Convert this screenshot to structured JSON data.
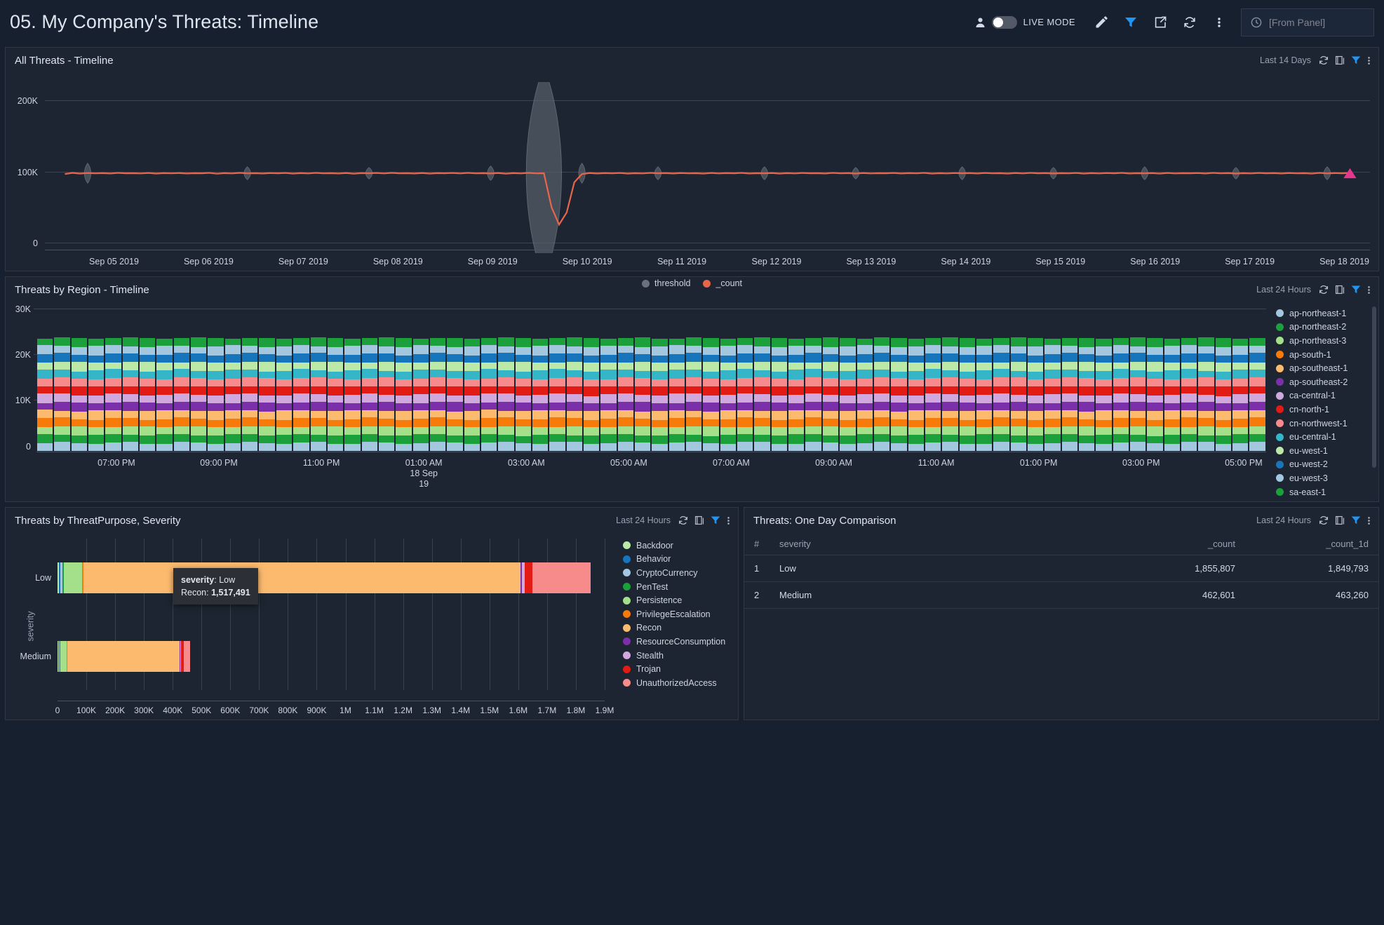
{
  "header": {
    "title": "05. My Company's Threats: Timeline",
    "live_mode_label": "LIVE MODE",
    "user_icon": "user-icon",
    "edit_icon": "pencil-icon",
    "filter_icon": "filter-icon",
    "share_icon": "share-icon",
    "refresh_icon": "refresh-icon",
    "more_icon": "kebab-menu-icon",
    "timepicker": {
      "clock_icon": "clock-icon",
      "value": "[From Panel]"
    }
  },
  "panel_controls": {
    "refresh_icon": "refresh-icon",
    "duplicate_icon": "duplicate-icon",
    "filter_icon": "filter-icon",
    "more_icon": "kebab-menu-icon"
  },
  "panels": {
    "all_threats": {
      "title": "All Threats - Timeline",
      "range": "Last 14 Days"
    },
    "by_region": {
      "title": "Threats by Region - Timeline",
      "range": "Last 24 Hours"
    },
    "by_purpose": {
      "title": "Threats by ThreatPurpose, Severity",
      "range": "Last 24 Hours"
    },
    "one_day": {
      "title": "Threats: One Day Comparison",
      "range": "Last 24 Hours"
    }
  },
  "chart_data": [
    {
      "id": "all-threats-timeline",
      "type": "line",
      "title": "All Threats - Timeline",
      "xlabel": "",
      "ylabel": "",
      "ylim": [
        0,
        200000
      ],
      "yticks": [
        "0",
        "100K",
        "200K"
      ],
      "ytick_values": [
        0,
        100000,
        200000
      ],
      "grid": true,
      "xtick_labels": [
        "Sep 05 2019",
        "Sep 06 2019",
        "Sep 07 2019",
        "Sep 08 2019",
        "Sep 09 2019",
        "Sep 10 2019",
        "Sep 11 2019",
        "Sep 12 2019",
        "Sep 13 2019",
        "Sep 14 2019",
        "Sep 15 2019",
        "Sep 16 2019",
        "Sep 17 2019",
        "Sep 18 2019"
      ],
      "legend": [
        {
          "label": "threshold",
          "color": "#6a717d"
        },
        {
          "label": "_count",
          "color": "#e7664c"
        }
      ],
      "legend_position": "bottom",
      "series": [
        {
          "name": "_count",
          "color": "#e7664c",
          "values": [
            99000,
            100500,
            99500,
            100200,
            99800,
            100100,
            99600,
            100400,
            99900,
            100000,
            99700,
            100300,
            99500,
            100100,
            99800,
            100200,
            99600,
            100000,
            99900,
            100400,
            99300,
            100100,
            99700,
            100500,
            99800,
            100000,
            99600,
            100200,
            99900,
            100300,
            99500,
            100100,
            99700,
            100400,
            99800,
            100000,
            99600,
            100200,
            99400,
            100100,
            99900,
            100300,
            99700,
            100500,
            99800,
            100000,
            99600,
            100200,
            99500,
            100100,
            99900,
            100300,
            99700,
            100400,
            99800,
            100000,
            99600,
            100200,
            99400,
            100100,
            99700,
            100500,
            99800,
            100000,
            55000,
            32000,
            48000,
            88000,
            99000,
            100200,
            99600,
            100100,
            99800,
            100300,
            99500,
            100000,
            99700,
            100400,
            99900,
            100100,
            99600,
            100200,
            99800,
            100000,
            99500,
            100300,
            99700,
            100100,
            99900,
            100400,
            99600,
            100000,
            99800,
            100200,
            99500,
            100100,
            99700,
            100300,
            99900,
            100000,
            99600,
            100400,
            99800,
            100100,
            99500,
            100200,
            99700,
            100000,
            99900,
            100300,
            99600,
            100100,
            99800,
            100400,
            99500,
            100000,
            99700,
            100200,
            99900,
            100100,
            99600,
            100300,
            99800,
            100000,
            99500,
            100200,
            99700,
            100400,
            99900,
            100100,
            99600,
            100000,
            99800,
            100300,
            99500,
            100100,
            99700,
            100200,
            99900,
            100400,
            99600,
            100000,
            99800,
            100100,
            99500,
            100300,
            99700,
            100000,
            99900,
            100200,
            99600,
            100400,
            99800,
            100100,
            99500,
            100000,
            99700,
            100300,
            99900,
            100100,
            99600,
            100200,
            99800,
            100000,
            99500,
            100400,
            99700,
            100100,
            99900,
            100300
          ]
        },
        {
          "name": "threshold",
          "color": "#6a717d",
          "description": "grey lens/envelope band around the count line, widest near Sep 10 2019"
        }
      ],
      "end_marker": {
        "shape": "triangle",
        "color": "#e8368f",
        "x_label": "Sep 18 2019",
        "y": 100000
      }
    },
    {
      "id": "threats-by-region-timeline",
      "type": "bar",
      "stacked": true,
      "title": "Threats by Region - Timeline",
      "ylim": [
        0,
        30000
      ],
      "yticks": [
        "0",
        "10K",
        "20K",
        "30K"
      ],
      "ytick_values": [
        0,
        10000,
        20000,
        30000
      ],
      "bar_count": 72,
      "bar_total_approx": 24000,
      "xtick_labels": [
        "07:00 PM",
        "09:00 PM",
        "11:00 PM",
        "01:00 AM",
        "03:00 AM",
        "05:00 AM",
        "07:00 AM",
        "09:00 AM",
        "11:00 AM",
        "01:00 PM",
        "03:00 PM",
        "05:00 PM"
      ],
      "xtick_sublabels": [
        "",
        "",
        "",
        "18 Sep\n19",
        "",
        "",
        "",
        "",
        "",
        "",
        "",
        ""
      ],
      "legend_position": "right",
      "series": [
        {
          "name": "ap-northeast-1",
          "color": "#a4c7e0",
          "value": 1700
        },
        {
          "name": "ap-northeast-2",
          "color": "#1ba03c",
          "value": 1700
        },
        {
          "name": "ap-northeast-3",
          "color": "#a4e08a",
          "value": 1700
        },
        {
          "name": "ap-south-1",
          "color": "#f77b0b",
          "value": 1700
        },
        {
          "name": "ap-southeast-1",
          "color": "#fcba6e",
          "value": 1700
        },
        {
          "name": "ap-southeast-2",
          "color": "#7b2fa8",
          "value": 1700
        },
        {
          "name": "ca-central-1",
          "color": "#d0a8dd",
          "value": 1700
        },
        {
          "name": "cn-north-1",
          "color": "#e21b14",
          "value": 1700
        },
        {
          "name": "cn-northwest-1",
          "color": "#f78a8a",
          "value": 1700
        },
        {
          "name": "eu-central-1",
          "color": "#35b5c8",
          "value": 1700
        },
        {
          "name": "eu-west-1",
          "color": "#bce8a8",
          "value": 1700
        },
        {
          "name": "eu-west-2",
          "color": "#1775bb",
          "value": 1700
        },
        {
          "name": "eu-west-3",
          "color": "#a4c7e0",
          "value": 1700
        },
        {
          "name": "sa-east-1",
          "color": "#1ba03c",
          "value": 1700
        }
      ]
    },
    {
      "id": "threats-by-threatpurpose-severity",
      "type": "bar",
      "orientation": "horizontal",
      "stacked": true,
      "title": "Threats by ThreatPurpose, Severity",
      "ylabel": "severity",
      "xlabel": "",
      "xlim": [
        0,
        1900000
      ],
      "categories": [
        "Low",
        "Medium"
      ],
      "xtick_labels": [
        "0",
        "100K",
        "200K",
        "300K",
        "400K",
        "500K",
        "600K",
        "700K",
        "800K",
        "900K",
        "1M",
        "1.1M",
        "1.2M",
        "1.3M",
        "1.4M",
        "1.5M",
        "1.6M",
        "1.7M",
        "1.8M",
        "1.9M"
      ],
      "xtick_values": [
        0,
        100000,
        200000,
        300000,
        400000,
        500000,
        600000,
        700000,
        800000,
        900000,
        1000000,
        1100000,
        1200000,
        1300000,
        1400000,
        1500000,
        1600000,
        1700000,
        1800000,
        1900000
      ],
      "legend_position": "right",
      "series": [
        {
          "name": "Backdoor",
          "color": "#bce8a8",
          "values": [
            6000,
            3000
          ]
        },
        {
          "name": "Behavior",
          "color": "#1775bb",
          "values": [
            4000,
            2000
          ]
        },
        {
          "name": "CryptoCurrency",
          "color": "#a4c7e0",
          "values": [
            8000,
            3000
          ]
        },
        {
          "name": "PenTest",
          "color": "#1ba03c",
          "values": [
            5000,
            2000
          ]
        },
        {
          "name": "Persistence",
          "color": "#a4e08a",
          "values": [
            62000,
            22000
          ]
        },
        {
          "name": "PrivilegeEscalation",
          "color": "#f77b0b",
          "values": [
            5000,
            2000
          ]
        },
        {
          "name": "Recon",
          "color": "#fcba6e",
          "values": [
            1517491,
            390000
          ]
        },
        {
          "name": "ResourceConsumption",
          "color": "#7b2fa8",
          "values": [
            6000,
            2500
          ]
        },
        {
          "name": "Stealth",
          "color": "#d0a8dd",
          "values": [
            9000,
            3000
          ]
        },
        {
          "name": "Trojan",
          "color": "#e21b14",
          "values": [
            28000,
            9000
          ]
        },
        {
          "name": "UnauthorizedAccess",
          "color": "#f78a8a",
          "values": [
            200000,
            22000
          ]
        }
      ],
      "row_totals": [
        1855807,
        462601
      ],
      "tooltip": {
        "line1_key": "severity",
        "line1_value": "Low",
        "line2_key": "Recon",
        "line2_value": "1,517,491"
      }
    },
    {
      "id": "threats-one-day-comparison",
      "type": "table",
      "title": "Threats: One Day Comparison",
      "columns": [
        "#",
        "severity",
        "_count",
        "_count_1d"
      ],
      "rows": [
        {
          "index": "1",
          "severity": "Low",
          "count": "1,855,807",
          "count_1d": "1,849,793"
        },
        {
          "index": "2",
          "severity": "Medium",
          "count": "462,601",
          "count_1d": "463,260"
        }
      ]
    }
  ],
  "colors": {
    "background": "#16202f",
    "panel": "#1d2532",
    "border": "#343741",
    "accent": "#36a2ef",
    "text": "#d3dae6",
    "muted": "#98a2b3"
  }
}
